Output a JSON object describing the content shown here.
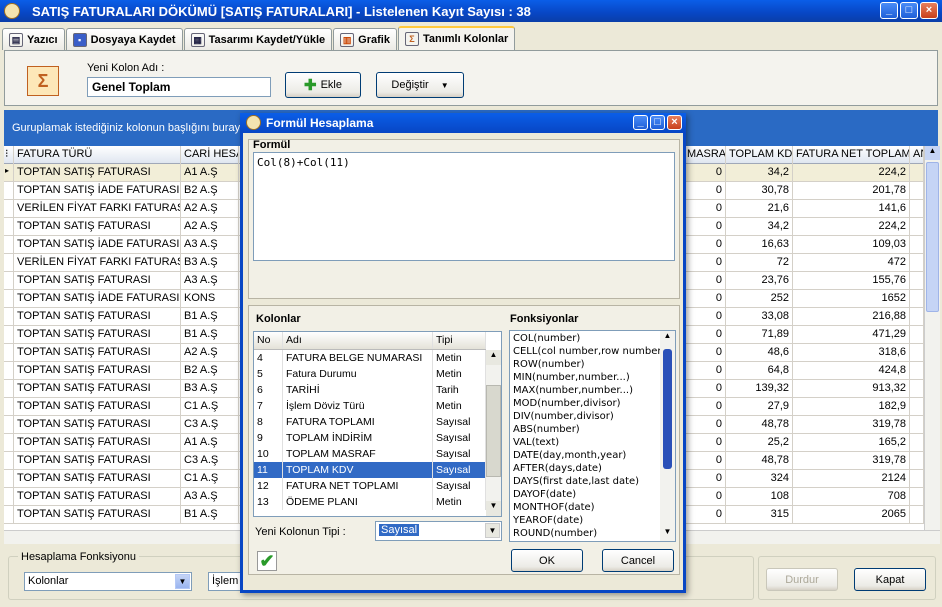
{
  "window": {
    "title": "SATIŞ FATURALARI DÖKÜMÜ [SATIŞ FATURALARI]  -  Listelenen Kayıt Sayısı : 38"
  },
  "tabs": [
    {
      "label": "Yazıcı"
    },
    {
      "label": "Dosyaya Kaydet"
    },
    {
      "label": "Tasarımı Kaydet/Yükle"
    },
    {
      "label": "Grafik"
    },
    {
      "label": "Tanımlı Kolonlar"
    }
  ],
  "panel": {
    "new_column_label": "Yeni Kolon Adı :",
    "new_column_value": "Genel Toplam",
    "add_label": "Ekle",
    "change_label": "Değiştir"
  },
  "group_hint": "Guruplamak istediğiniz kolonun başlığını buraya",
  "grid": {
    "headers": [
      "FATURA TÜRÜ",
      "CARİ HESA",
      "MASRAF",
      "TOPLAM KDV",
      "FATURA NET TOPLAMI",
      "AN"
    ],
    "rows": [
      [
        "TOPTAN SATIŞ FATURASI",
        "A1 A.Ş",
        "0",
        "34,2",
        "224,2"
      ],
      [
        "TOPTAN SATIŞ İADE FATURASI",
        "B2 A.Ş",
        "0",
        "30,78",
        "201,78"
      ],
      [
        "VERİLEN FİYAT FARKI FATURASI",
        "A2 A.Ş",
        "0",
        "21,6",
        "141,6"
      ],
      [
        "TOPTAN SATIŞ FATURASI",
        "A2 A.Ş",
        "0",
        "34,2",
        "224,2"
      ],
      [
        "TOPTAN SATIŞ İADE FATURASI",
        "A3 A.Ş",
        "0",
        "16,63",
        "109,03"
      ],
      [
        "VERİLEN FİYAT FARKI FATURASI",
        "B3 A.Ş",
        "0",
        "72",
        "472"
      ],
      [
        "TOPTAN SATIŞ FATURASI",
        "A3 A.Ş",
        "0",
        "23,76",
        "155,76"
      ],
      [
        "TOPTAN SATIŞ İADE FATURASI",
        "KONS",
        "0",
        "252",
        "1652"
      ],
      [
        "TOPTAN SATIŞ FATURASI",
        "B1 A.Ş",
        "0",
        "33,08",
        "216,88"
      ],
      [
        "TOPTAN SATIŞ FATURASI",
        "B1 A.Ş",
        "0",
        "71,89",
        "471,29"
      ],
      [
        "TOPTAN SATIŞ FATURASI",
        "A2 A.Ş",
        "0",
        "48,6",
        "318,6"
      ],
      [
        "TOPTAN SATIŞ FATURASI",
        "B2 A.Ş",
        "0",
        "64,8",
        "424,8"
      ],
      [
        "TOPTAN SATIŞ FATURASI",
        "B3 A.Ş",
        "0",
        "139,32",
        "913,32"
      ],
      [
        "TOPTAN SATIŞ FATURASI",
        "C1 A.Ş",
        "0",
        "27,9",
        "182,9"
      ],
      [
        "TOPTAN SATIŞ FATURASI",
        "C3 A.Ş",
        "0",
        "48,78",
        "319,78"
      ],
      [
        "TOPTAN SATIŞ FATURASI",
        "A1 A.Ş",
        "0",
        "25,2",
        "165,2"
      ],
      [
        "TOPTAN SATIŞ FATURASI",
        "C3 A.Ş",
        "0",
        "48,78",
        "319,78"
      ],
      [
        "TOPTAN SATIŞ FATURASI",
        "C1 A.Ş",
        "0",
        "324",
        "2124"
      ],
      [
        "TOPTAN SATIŞ FATURASI",
        "A3 A.Ş",
        "0",
        "108",
        "708"
      ],
      [
        "TOPTAN SATIŞ FATURASI",
        "B1 A.Ş",
        "0",
        "315",
        "2065"
      ]
    ]
  },
  "bottom": {
    "calc_legend": "Hesaplama Fonksiyonu",
    "calc_value": "Kolonlar",
    "op_value": "İşlem",
    "stop_label": "Durdur",
    "close_label": "Kapat"
  },
  "dialog": {
    "title": "Formül Hesaplama",
    "formula_label": "Formül",
    "formula_value": "Col(8)+Col(11)",
    "operators": [
      "+",
      "-",
      "/",
      "*",
      "=",
      ">",
      "<",
      "(",
      ")",
      "()",
      "&",
      "|"
    ],
    "columns_label": "Kolonlar",
    "functions_label": "Fonksiyonlar",
    "col_headers": [
      "No",
      "Adı",
      "Tipi"
    ],
    "columns": [
      [
        "4",
        "FATURA BELGE NUMARASI",
        "Metin"
      ],
      [
        "5",
        "Fatura Durumu",
        "Metin"
      ],
      [
        "6",
        "TARİHİ",
        "Tarih"
      ],
      [
        "7",
        "İşlem Döviz Türü",
        "Metin"
      ],
      [
        "8",
        "FATURA TOPLAMI",
        "Sayısal"
      ],
      [
        "9",
        "TOPLAM İNDİRİM",
        "Sayısal"
      ],
      [
        "10",
        "TOPLAM MASRAF",
        "Sayısal"
      ],
      [
        "11",
        "TOPLAM KDV",
        "Sayısal"
      ],
      [
        "12",
        "FATURA NET TOPLAMI",
        "Sayısal"
      ],
      [
        "13",
        "ÖDEME PLANI",
        "Metin"
      ]
    ],
    "selected_column_index": 7,
    "functions": [
      "COL(number)",
      "CELL(col number,row number)",
      "ROW(number)",
      "MIN(number,number...)",
      "MAX(number,number...)",
      "MOD(number,divisor)",
      "DIV(number,divisor)",
      "ABS(number)",
      "VAL(text)",
      "DATE(day,month,year)",
      "AFTER(days,date)",
      "DAYS(first date,last date)",
      "DAYOF(date)",
      "MONTHOF(date)",
      "YEAROF(date)",
      "ROUND(number)"
    ],
    "type_label": "Yeni Kolonun Tipi :",
    "type_value": "Sayısal",
    "ok_label": "OK",
    "cancel_label": "Cancel"
  }
}
